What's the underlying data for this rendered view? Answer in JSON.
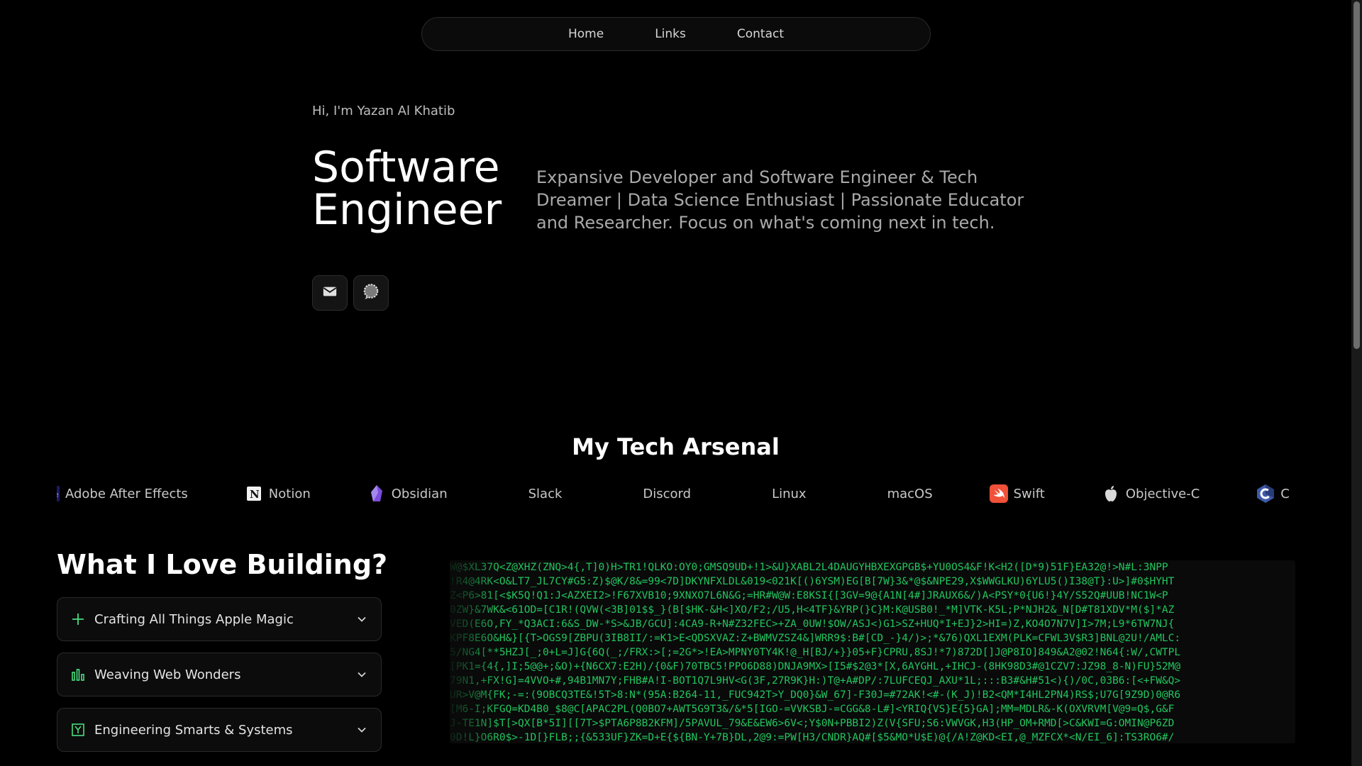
{
  "nav": {
    "items": [
      "Home",
      "Links",
      "Contact"
    ]
  },
  "hero": {
    "greeting": "Hi, I'm Yazan Al Khatib",
    "title_line1": "Software",
    "title_line2": "Engineer",
    "description": "Expansive Developer and Software Engineer & Tech Dreamer | Data Science Enthusiast | Passionate Educator and Researcher. Focus on what's coming next in tech.",
    "social": [
      {
        "name": "mail-icon"
      },
      {
        "name": "chat-icon"
      }
    ]
  },
  "arsenal": {
    "title": "My Tech Arsenal",
    "items": [
      {
        "label": "Adobe After Effects",
        "icon": "after-effects-icon"
      },
      {
        "label": "Notion",
        "icon": "notion-icon"
      },
      {
        "label": "Obsidian",
        "icon": "obsidian-icon"
      },
      {
        "label": "Slack",
        "icon": "slack-icon"
      },
      {
        "label": "Discord",
        "icon": "discord-icon"
      },
      {
        "label": "Linux",
        "icon": "linux-icon"
      },
      {
        "label": "macOS",
        "icon": "macos-icon"
      },
      {
        "label": "Swift",
        "icon": "swift-icon"
      },
      {
        "label": "Objective-C",
        "icon": "apple-icon"
      },
      {
        "label": "C",
        "icon": "c-icon"
      }
    ]
  },
  "love": {
    "title": "What I Love Building?",
    "items": [
      {
        "label": "Crafting All Things Apple Magic",
        "icon": "plus-icon"
      },
      {
        "label": "Weaving Web Wonders",
        "icon": "bar-chart-icon"
      },
      {
        "label": "Engineering Smarts & Systems",
        "icon": "bracket-y-icon"
      }
    ]
  },
  "matrix": {
    "lines": [
      "W@$XL37Q<Z@XHZ(ZNQ>4{,T]0)H>TR1!QLKO:OY0;GMSQ9UD+!1>&U}XABL2L4DAUGYHBXEXGPGB$+YU0OS4&F!K<H2([D*9)51F}EA32@!>N#L:3NPP",
      "!R4@4RK<O&LT7_JL7CY#G5:Z)$@K/8&=99<7D]DKYNFXLDL&019<021K[()6YSM)EG[B[7W}3&*@$&NPE29,X$WWGLKU)6YLU5()I38@T}:U>]#0$HYHT",
      "Z<P6>81[<$K5Q!Q1:J<AZXEI2>!F67XVB10;9XNXO7L6N&G;=HR#W@W:E8KSI{[3GV=9@{A1N[4#]JRAUX6&/)A<PSY*0{U6!}4Y/S52Q#UUB!NC1W<P",
      "0ZW}&7WK&<61OD=[C1R!(QVW(<3B]01$$_}(B[$HK-&H<]XO/F2;/U5,H<4TF}&YRP(}C}M:K@USB0!_*M]VTK-K5L;P*NJH2&_N[D#T81XDV*M($]*AZ",
      "VED(E6O,FY_*Q3ACI:6&S_DW-*S>&JB/GCU]:4CA9-R+N#Z32FEC>+ZA_0UW!$OW/ASJ<)G1>SZ+HUQ*I+EJ}2>HI=)Z,KO4O7N7V]I>7M;L9*6TW7NJ{",
      "KPF8E6O&H&}[{T>OGS9[ZBPU(3IB8II/:=K1>E<QDSXVAZ:Z+BWMVZSZ4&]WRR9$:B#[CD_-}4/)>;*&76)QXL1EXM(PLK=CFWL3V$R3]BNL@2U!/AMLC:",
      "5/NG4[**5HZJ[_;0+L=J]G{6Q(_;/FRX:>[;=2G*>!EA>MPNY0TY4K!@_H[BJ/+}}05+F}CPRU,8SJ!*7)872D[]J@P8IO]849&A2@02!N64{:W/,CWTPL",
      "[PK1={4{,]I;5@@+;&O)+{N6CX7:E2H)/{0&F)70TBC5!PPO6D88)DNJA9MX>[I5#$2@3*[X,6AYGHL,+IHCJ-(8HK98D3#@1CZV7:JZ98_8-N)FU}52M@",
      "79N1,+FX!G]=4VVO+#,94B1MN7Y;FHB#A!I-BOT1Q7L9HV<G(3F,27R9K}H:)T@+A#DP/:7LUFCEQJ_AXU*1L;:::B3#&H#51<){)/0C,03B6:[<+FW&Q>",
      "UR>V@M{FK;-=:(9OBCQ3TE&!5T>8:N*(95A:B264-11,_FUC942T>Y_DQ0}&W_67]-F30J=#72AK!<#-(K_J)!B2<QM*I4HL2PN4)RS$;U7G[9Z9D)0@R6",
      "[M6-I;KFGQ=KD4B0_$8@C[APAC2PL(Q0BO7+AWT5G9T3&/&*5[IGO-=VVKSBJ-=CGG&8-L#]<YRIQ{VS}E{5}GA];MM=MDLR&-K(OXVRVM[V@9=Q$,G&F",
      "J-TE1N]$T[>QX[B*5I][[7T>$PTA6P8B2KFM]/5PAVUL_79&E&EW6>6V<;Y$0N+PBBI2)Z(V{SFU;S6:VWVGK,H3(HP_OM+RMD[>C&KWI=G:OMIN@P6ZD",
      "0D!L}O6R0$>-1D[}FLB;;{&533UF}ZK=D+E{${BN-Y+7B}DL,2@9:=PW[H3/CNDR}AQ#[$5&MO*U$E)@{/A!Z@KD<EI,@_MZFCX*<N/EI_6]:TS3RO6#/"
    ]
  },
  "colors": {
    "background": "#000000",
    "matrix_green": "#22c55e",
    "accent_green": "#4ade80"
  }
}
